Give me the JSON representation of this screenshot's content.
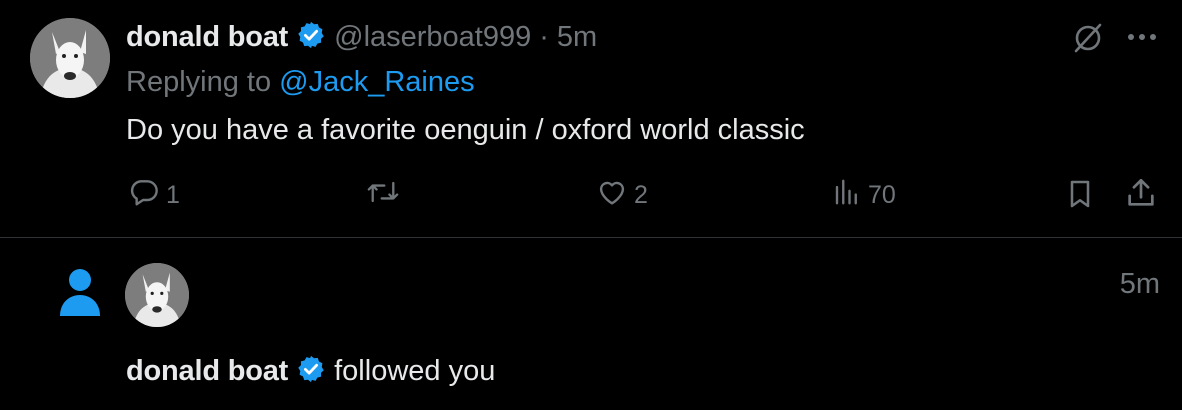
{
  "tweet": {
    "author_name": "donald boat",
    "handle": "@laserboat999",
    "separator": "·",
    "time": "5m",
    "replying_prefix": "Replying to",
    "replying_handle": "@Jack_Raines",
    "text": "Do you have a favorite oenguin / oxford world classic",
    "actions": {
      "reply_count": "1",
      "retweet_count": "",
      "like_count": "2",
      "views_count": "70"
    },
    "icons": {
      "verified": "verified-badge-icon",
      "grok": "grok-icon",
      "more": "more-icon",
      "reply": "reply-icon",
      "retweet": "retweet-icon",
      "like": "heart-icon",
      "views": "views-icon",
      "bookmark": "bookmark-icon",
      "share": "share-icon"
    }
  },
  "notification": {
    "time": "5m",
    "actor_name": "donald boat",
    "action_text": "followed you",
    "icons": {
      "type": "person-icon",
      "verified": "verified-badge-icon"
    }
  },
  "colors": {
    "background": "#000000",
    "text": "#e7e9ea",
    "muted": "#71767b",
    "accent": "#1d9bf0",
    "divider": "#2f3336"
  }
}
